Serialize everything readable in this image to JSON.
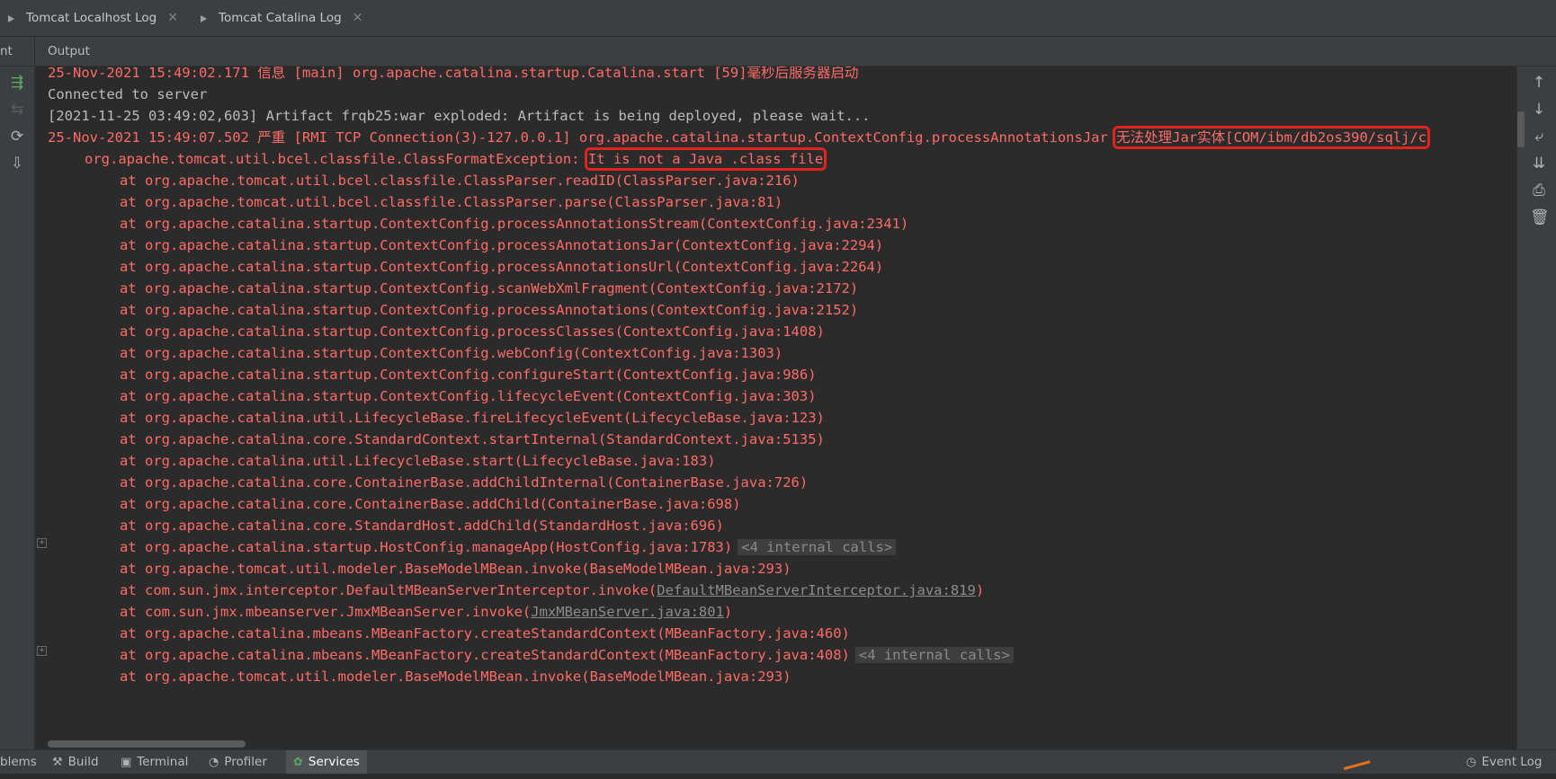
{
  "tabs": [
    {
      "label": "Tomcat Localhost Log",
      "close": "✕"
    },
    {
      "label": "Tomcat Catalina Log",
      "close": "✕"
    }
  ],
  "output_header": {
    "left_fragment": "nt",
    "label": "Output"
  },
  "console_lines": [
    "25-Nov-2021 15:49:02.171 信息 [main] org.apache.catalina.startup.Catalina.start [59]毫秒后服务器启动",
    "Connected to server",
    "[2021-11-25 03:49:02,603] Artifact frqb25:war exploded: Artifact is being deployed, please wait...",
    "25-Nov-2021 15:49:07.502 严重 [RMI TCP Connection(3)-127.0.0.1] org.apache.catalina.startup.ContextConfig.processAnnotationsJar ",
    "无法处理Jar实体[COM/ibm/db2os390/sqlj/c",
    "org.apache.tomcat.util.bcel.classfile.ClassFormatException: ",
    "It is not a Java .class file",
    "at org.apache.tomcat.util.bcel.classfile.ClassParser.readID(ClassParser.java:216)",
    "at org.apache.tomcat.util.bcel.classfile.ClassParser.parse(ClassParser.java:81)",
    "at org.apache.catalina.startup.ContextConfig.processAnnotationsStream(ContextConfig.java:2341)",
    "at org.apache.catalina.startup.ContextConfig.processAnnotationsJar(ContextConfig.java:2294)",
    "at org.apache.catalina.startup.ContextConfig.processAnnotationsUrl(ContextConfig.java:2264)",
    "at org.apache.catalina.startup.ContextConfig.scanWebXmlFragment(ContextConfig.java:2172)",
    "at org.apache.catalina.startup.ContextConfig.processAnnotations(ContextConfig.java:2152)",
    "at org.apache.catalina.startup.ContextConfig.processClasses(ContextConfig.java:1408)",
    "at org.apache.catalina.startup.ContextConfig.webConfig(ContextConfig.java:1303)",
    "at org.apache.catalina.startup.ContextConfig.configureStart(ContextConfig.java:986)",
    "at org.apache.catalina.startup.ContextConfig.lifecycleEvent(ContextConfig.java:303)",
    "at org.apache.catalina.util.LifecycleBase.fireLifecycleEvent(LifecycleBase.java:123)",
    "at org.apache.catalina.core.StandardContext.startInternal(StandardContext.java:5135)",
    "at org.apache.catalina.util.LifecycleBase.start(LifecycleBase.java:183)",
    "at org.apache.catalina.core.ContainerBase.addChildInternal(ContainerBase.java:726)",
    "at org.apache.catalina.core.ContainerBase.addChild(ContainerBase.java:698)",
    "at org.apache.catalina.core.StandardHost.addChild(StandardHost.java:696)",
    "at org.apache.catalina.startup.HostConfig.manageApp(HostConfig.java:1783)",
    "<4 internal calls>",
    "at org.apache.tomcat.util.modeler.BaseModelMBean.invoke(BaseModelMBean.java:293)",
    "at com.sun.jmx.interceptor.DefaultMBeanServerInterceptor.invoke(",
    "DefaultMBeanServerInterceptor.java:819",
    ")",
    "at com.sun.jmx.mbeanserver.JmxMBeanServer.invoke(",
    "JmxMBeanServer.java:801",
    ")",
    "at org.apache.catalina.mbeans.MBeanFactory.createStandardContext(MBeanFactory.java:460)",
    "at org.apache.catalina.mbeans.MBeanFactory.createStandardContext(MBeanFactory.java:408)",
    "<4 internal calls>",
    "at org.apache.tomcat.util.modeler.BaseModelMBean.invoke(BaseModelMBean.java:293)"
  ],
  "bottom_tabs": [
    {
      "label": "blems"
    },
    {
      "label": "Build"
    },
    {
      "label": "Terminal"
    },
    {
      "label": "Profiler"
    },
    {
      "label": "Services"
    },
    {
      "label": "Event Log"
    }
  ],
  "fold_marker": "+",
  "colors": {
    "error": "#ff6b68",
    "normal": "#bbbbbb",
    "highlight_box": "#e0231b",
    "background": "#2b2b2b"
  },
  "left_icons": [
    "rerun-icon",
    "stop-icon",
    "refresh-icon",
    "deploy-icon"
  ],
  "right_icons": [
    "arrow-up-icon",
    "arrow-down-icon",
    "soft-wrap-icon",
    "scroll-to-end-icon",
    "print-icon",
    "trash-icon"
  ]
}
